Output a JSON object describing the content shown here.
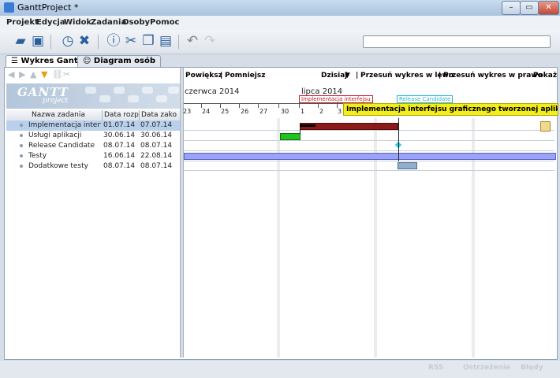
{
  "window": {
    "title": "GanttProject *"
  },
  "menu": [
    "Projekt",
    "Edycja",
    "Widok",
    "Zadania",
    "Osoby",
    "Pomoc"
  ],
  "toolbar": {
    "icons": [
      "open-folder-icon",
      "save-icon",
      "clock-icon",
      "delete-icon",
      "info-icon",
      "cut-icon",
      "copy-icon",
      "paste-icon",
      "undo-icon",
      "redo-icon"
    ],
    "search_value": ""
  },
  "tabs": [
    "Wykres Gantta",
    "Diagram osób"
  ],
  "logo": {
    "text": "GANTT",
    "sub": "project"
  },
  "table": {
    "columns": [
      "Nazwa zadania",
      "Data rozp...",
      "Data zako..."
    ],
    "rows": [
      {
        "name": "Implementacja interfej...",
        "start": "01.07.14",
        "end": "07.07.14"
      },
      {
        "name": "Usługi aplikacji",
        "start": "30.06.14",
        "end": "30.06.14"
      },
      {
        "name": "Release Candidate",
        "start": "08.07.14",
        "end": "08.07.14"
      },
      {
        "name": "Testy",
        "start": "16.06.14",
        "end": "22.08.14"
      },
      {
        "name": "Dodatkowe testy",
        "start": "08.07.14",
        "end": "08.07.14"
      }
    ]
  },
  "gantt": {
    "toolbar": {
      "zoom_in": "Powiększ",
      "zoom_out": "Pomniejsz",
      "today": "Dzisiaj",
      "shift_left": "Przesuń wykres w lewo",
      "shift_right": "Przesuń wykres w prawo",
      "show": "Pokaż"
    },
    "months": [
      "czerwca 2014",
      "lipca 2014"
    ],
    "days": [
      "23",
      "24",
      "25",
      "26",
      "27",
      "30",
      "1",
      "2",
      "3"
    ],
    "tooltip": "Implementacja interfejsu graficznego tworzonej aplikacji webowej",
    "milestone_labels": [
      "Implementacja interfejsu",
      "Release Candidate"
    ],
    "colors": {
      "impl": "#8b1a1a",
      "uslugi": "#22c422",
      "testy": "#9aa3f5",
      "dodatkowe": "#8faecb",
      "milestone": "#27d6e8"
    }
  },
  "status": {
    "rss": "RSS",
    "warning": "Ostrzeżenie",
    "errors": "Błędy"
  }
}
